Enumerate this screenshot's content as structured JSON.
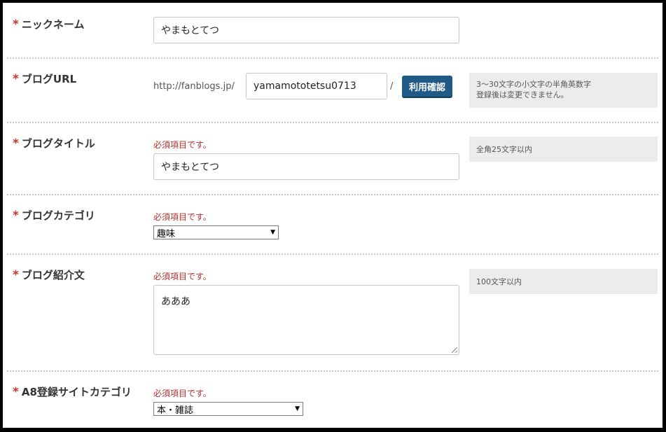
{
  "required_mark": "*",
  "error_text": "必須項目です。",
  "nickname": {
    "label": "ニックネーム",
    "value": "やまもとてつ"
  },
  "blog_url": {
    "label": "ブログURL",
    "prefix": "http://fanblogs.jp/",
    "value": "yamamototetsu0713",
    "slash": "/",
    "check_button": "利用確認",
    "hint_line1": "3〜30文字の小文字の半角英数字",
    "hint_line2": "登録後は変更できません。"
  },
  "blog_title": {
    "label": "ブログタイトル",
    "value": "やまもとてつ",
    "hint": "全角25文字以内"
  },
  "blog_category": {
    "label": "ブログカテゴリ",
    "selected": "趣味"
  },
  "blog_intro": {
    "label": "ブログ紹介文",
    "value": "あああ",
    "hint": "100文字以内"
  },
  "a8_category": {
    "label": "A8登録サイトカテゴリ",
    "selected": "本・雑誌"
  },
  "colors": {
    "required": "#c0392b",
    "error": "#b03030",
    "button": "#1f5b86",
    "hint_bg": "#ececec"
  }
}
